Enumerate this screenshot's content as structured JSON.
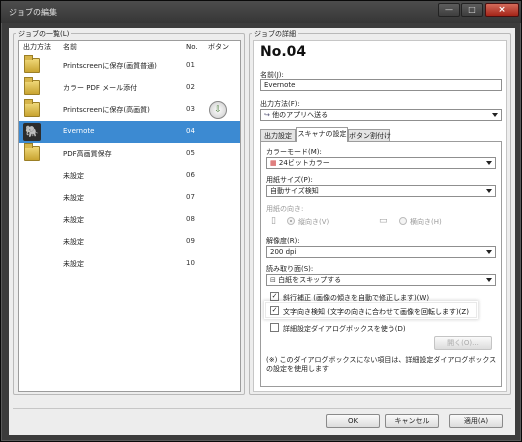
{
  "window": {
    "title": "ジョブの編集",
    "minimize": "—",
    "maximize": "□",
    "close": "×"
  },
  "job_list": {
    "group_label": "ジョブの一覧(L)",
    "columns": {
      "method": "出力方法",
      "name": "名前",
      "no": "No.",
      "button": "ボタン"
    },
    "rows": [
      {
        "icon": "folder-icon",
        "name": "Printscreenに保存(画質普通)",
        "no": "01",
        "selected": false,
        "button_icon": false
      },
      {
        "icon": "folder-icon",
        "name": "カラー PDF メール添付",
        "no": "02",
        "selected": false,
        "button_icon": false
      },
      {
        "icon": "folder-icon",
        "name": "Printscreenに保存(高画質)",
        "no": "03",
        "selected": false,
        "button_icon": true
      },
      {
        "icon": "evernote-icon",
        "name": "Evernote",
        "no": "04",
        "selected": true,
        "button_icon": false
      },
      {
        "icon": "folder-icon",
        "name": "PDF高画質保存",
        "no": "05",
        "selected": false,
        "button_icon": false
      },
      {
        "icon": "",
        "name": "未設定",
        "no": "06",
        "selected": false,
        "button_icon": false
      },
      {
        "icon": "",
        "name": "未設定",
        "no": "07",
        "selected": false,
        "button_icon": false
      },
      {
        "icon": "",
        "name": "未設定",
        "no": "08",
        "selected": false,
        "button_icon": false
      },
      {
        "icon": "",
        "name": "未設定",
        "no": "09",
        "selected": false,
        "button_icon": false
      },
      {
        "icon": "",
        "name": "未設定",
        "no": "10",
        "selected": false,
        "button_icon": false
      }
    ]
  },
  "details": {
    "group_label": "ジョブの詳細",
    "job_number": "No.04",
    "name_label": "名前(J):",
    "name_value": "Evernote",
    "output_label": "出力方法(F):",
    "output_value": "他のアプリへ送る",
    "tabs": [
      "出力設定",
      "スキャナの設定",
      "ボタン割付け"
    ],
    "active_tab": 1,
    "color_mode_label": "カラーモード(M):",
    "color_mode_value": "24ビットカラー",
    "paper_size_label": "用紙サイズ(P):",
    "paper_size_value": "自動サイズ検知",
    "orientation_label": "用紙の向き:",
    "portrait_label": "縦向き(V)",
    "landscape_label": "横向き(H)",
    "resolution_label": "解像度(R):",
    "resolution_value": "200 dpi",
    "side_label": "読み取り面(S):",
    "side_value": "白紙をスキップする",
    "deskew_label": "斜行補正 (画像の傾きを自動で修正します)(W)",
    "deskew_checked": "✓",
    "text_orientation_label": "文字向き検知 (文字の向きに合わせて画像を回転します)(Z)",
    "text_orientation_checked": "✓",
    "detail_dialog_label": "詳細設定ダイアログボックスを使う(D)",
    "open_button": "開く(O)...",
    "note": "(※) このダイアログボックスにない項目は、詳細設定ダイアログボックスの設定を使用します"
  },
  "footer": {
    "ok": "OK",
    "cancel": "キャンセル",
    "apply": "適用(A)"
  }
}
